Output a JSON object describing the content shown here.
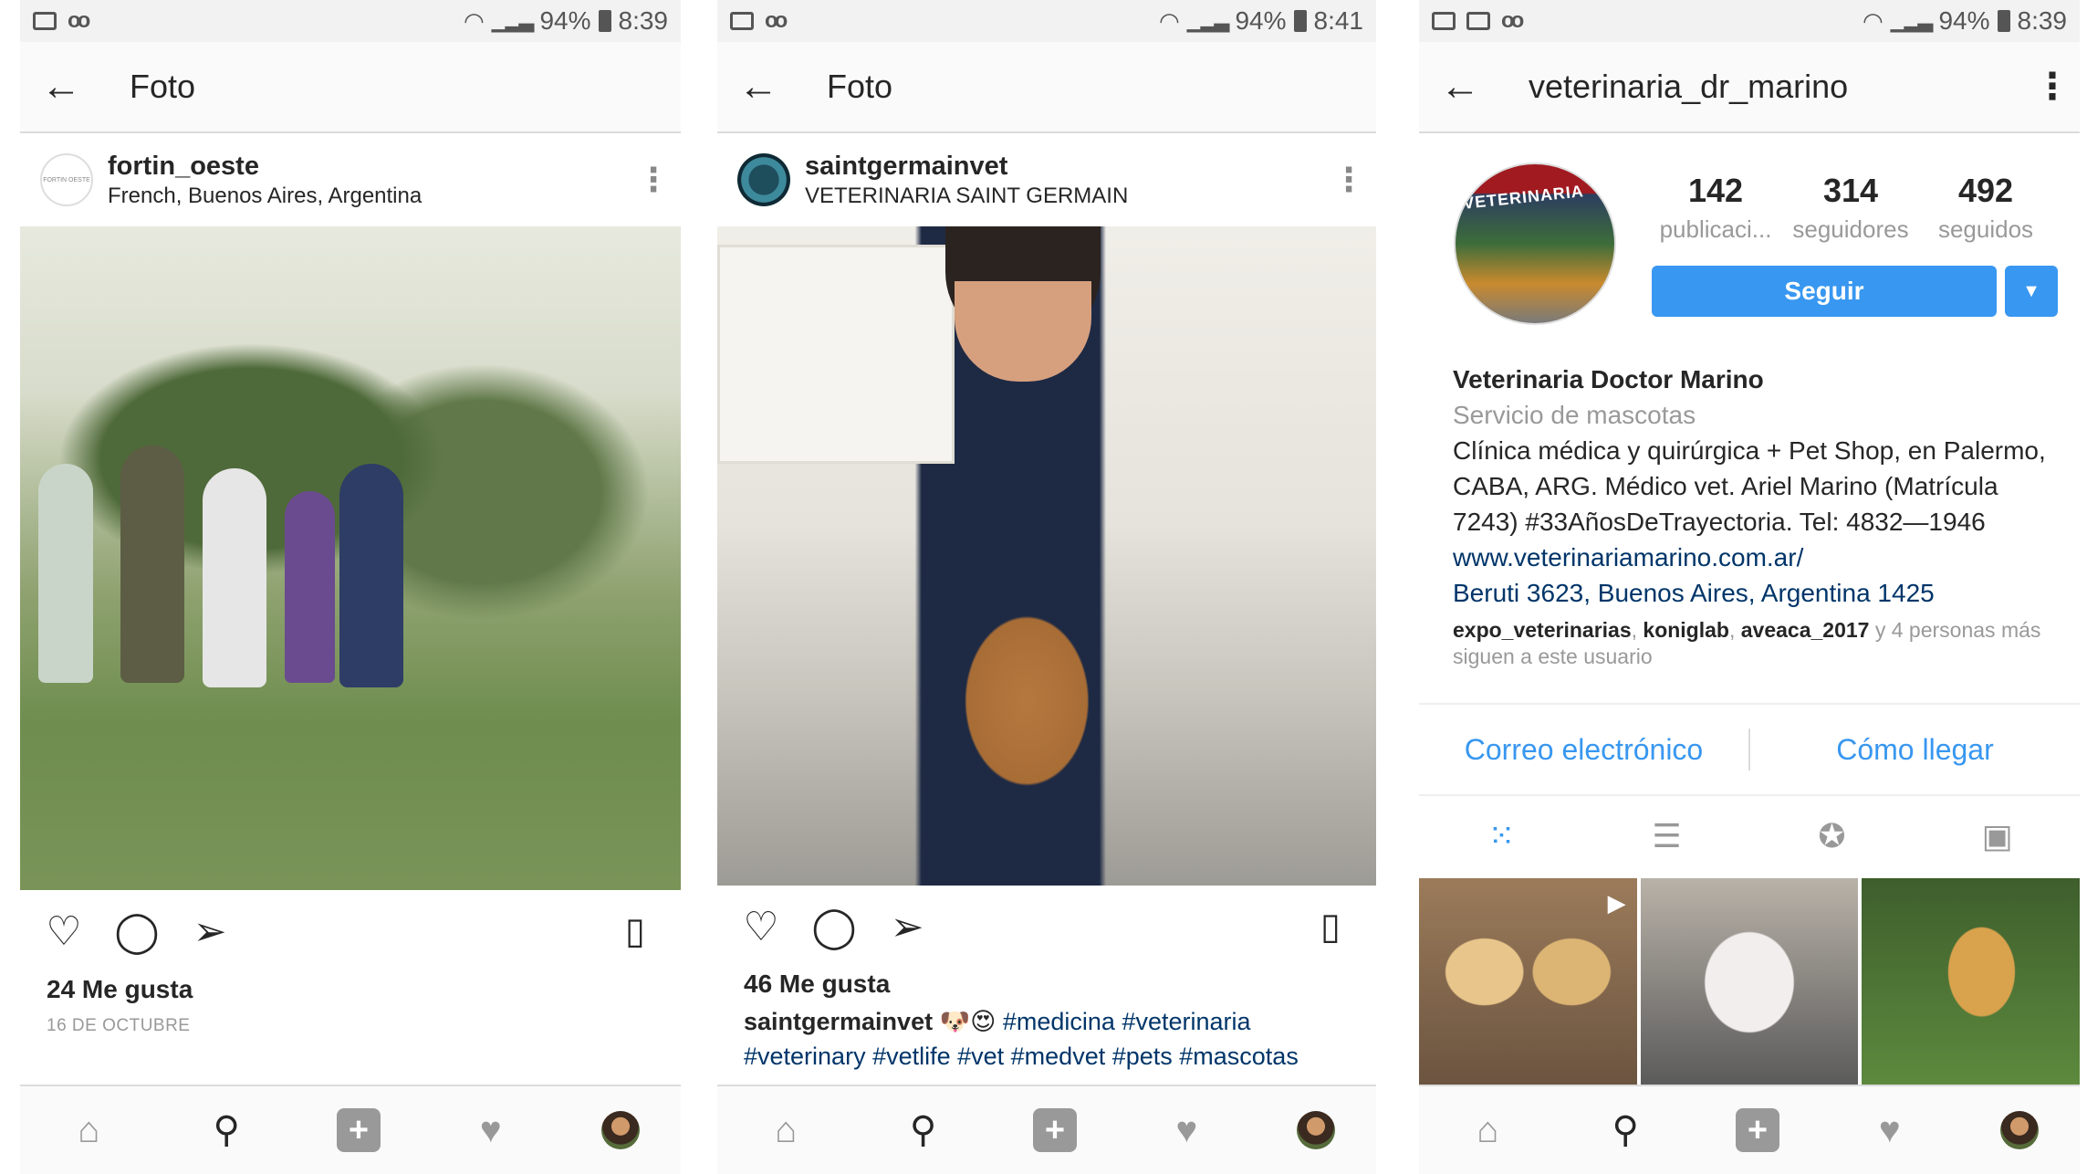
{
  "panels": [
    {
      "status": {
        "battery": "94%",
        "time": "8:39"
      },
      "appbar": {
        "title": "Foto"
      },
      "post": {
        "username": "fortin_oeste",
        "location": "French, Buenos Aires, Argentina",
        "avatar_text": "FORTIN OESTE",
        "likes": "24 Me gusta",
        "date": "16 DE OCTUBRE"
      }
    },
    {
      "status": {
        "battery": "94%",
        "time": "8:41"
      },
      "appbar": {
        "title": "Foto"
      },
      "post": {
        "username": "saintgermainvet",
        "location": "VETERINARIA SAINT GERMAIN",
        "likes": "46 Me gusta",
        "caption_user": "saintgermainvet",
        "caption_emoji": "🐶😍",
        "caption_tags_1": "#medicina #veterinaria",
        "caption_tags_2": "#veterinary #vetlife #vet #medvet #pets #mascotas"
      }
    },
    {
      "status": {
        "battery": "94%",
        "time": "8:39"
      },
      "appbar": {
        "title": "veterinaria_dr_marino"
      },
      "profile": {
        "avatar_text": "VETERINARIA",
        "stats": [
          {
            "value": "142",
            "label": "publicaci..."
          },
          {
            "value": "314",
            "label": "seguidores"
          },
          {
            "value": "492",
            "label": "seguidos"
          }
        ],
        "follow_label": "Seguir",
        "name": "Veterinaria Doctor Marino",
        "category": "Servicio de mascotas",
        "bio": "Clínica médica y quirúrgica + Pet Shop, en Palermo, CABA, ARG. Médico vet. Ariel Marino (Matrícula 7243) #33AñosDeTrayectoria. Tel: 4832—1946",
        "website": "www.veterinariamarino.com.ar/",
        "address": "Beruti 3623, Buenos Aires, Argentina 1425",
        "followed_by": [
          "expo_veterinarias",
          "koniglab",
          "aveaca_2017"
        ],
        "followed_rest": "y 4 personas más siguen a este usuario",
        "contact_email": "Correo electrónico",
        "contact_directions": "Cómo llegar"
      }
    }
  ],
  "icons": {
    "back": "arrow-left-icon",
    "like": "heart-outline-icon",
    "comment": "comment-icon",
    "share": "send-icon",
    "save": "bookmark-icon",
    "nav": [
      "home-icon",
      "search-icon",
      "add-icon",
      "heart-icon",
      "profile-avatar"
    ]
  },
  "colors": {
    "accent": "#3897f0",
    "link": "#003569",
    "muted": "#999999"
  }
}
